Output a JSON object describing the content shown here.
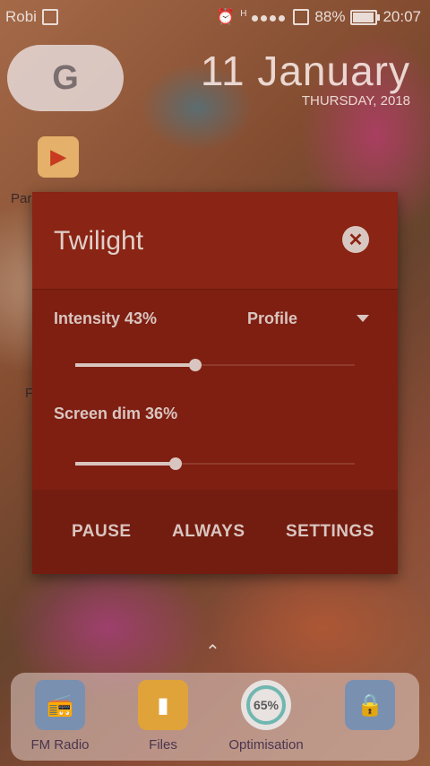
{
  "statusbar": {
    "carrier": "Robi",
    "network_hint": "H",
    "battery": "88%",
    "time": "20:07"
  },
  "homescreen": {
    "google_label": "G",
    "date": "11 January",
    "day": "THURSDAY, 2018",
    "partial_label_1": "Par",
    "partial_label_2": "F"
  },
  "dialog": {
    "title": "Twilight",
    "intensity_label": "Intensity 43%",
    "intensity_value": 0.43,
    "profile_label": "Profile",
    "screen_dim_label": "Screen dim 36%",
    "screen_dim_value": 0.36,
    "actions": {
      "pause": "PAUSE",
      "always": "ALWAYS",
      "settings": "SETTINGS"
    }
  },
  "dock": {
    "items": [
      {
        "label": "FM Radio",
        "icon": "radio-icon"
      },
      {
        "label": "Files",
        "icon": "folder-icon"
      },
      {
        "label": "Optimisation",
        "icon": "optimisation-icon",
        "value": "65%"
      },
      {
        "label": "",
        "icon": "lock-icon"
      }
    ]
  },
  "colors": {
    "dialog_bg": "#7e1f12",
    "dialog_header": "#8a2414",
    "dialog_actions": "#731c10",
    "text": "#d9c5bf"
  }
}
